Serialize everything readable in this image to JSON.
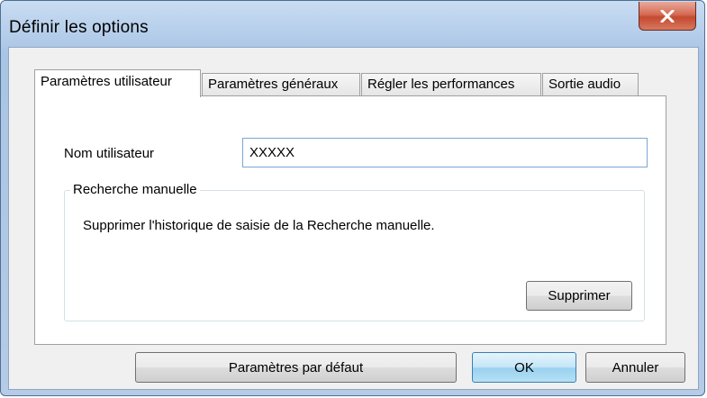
{
  "window": {
    "title": "Définir les options",
    "close_icon": "close-x-icon"
  },
  "tabs": [
    {
      "label": "Paramètres utilisateur",
      "active": true
    },
    {
      "label": "Paramètres généraux",
      "active": false
    },
    {
      "label": "Régler les performances",
      "active": false
    },
    {
      "label": "Sortie audio",
      "active": false
    }
  ],
  "user_settings": {
    "username_label": "Nom utilisateur",
    "username_value": "XXXXX",
    "manual_search": {
      "group_title": "Recherche manuelle",
      "description": "Supprimer l'historique de saisie de la Recherche manuelle.",
      "delete_label": "Supprimer"
    }
  },
  "footer": {
    "default_label": "Paramètres par défaut",
    "ok_label": "OK",
    "cancel_label": "Annuler"
  },
  "colors": {
    "titlebar": "#b3cce9",
    "close_button": "#c44a30",
    "panel": "#ffffff",
    "dialog_face": "#f0f0f0"
  }
}
